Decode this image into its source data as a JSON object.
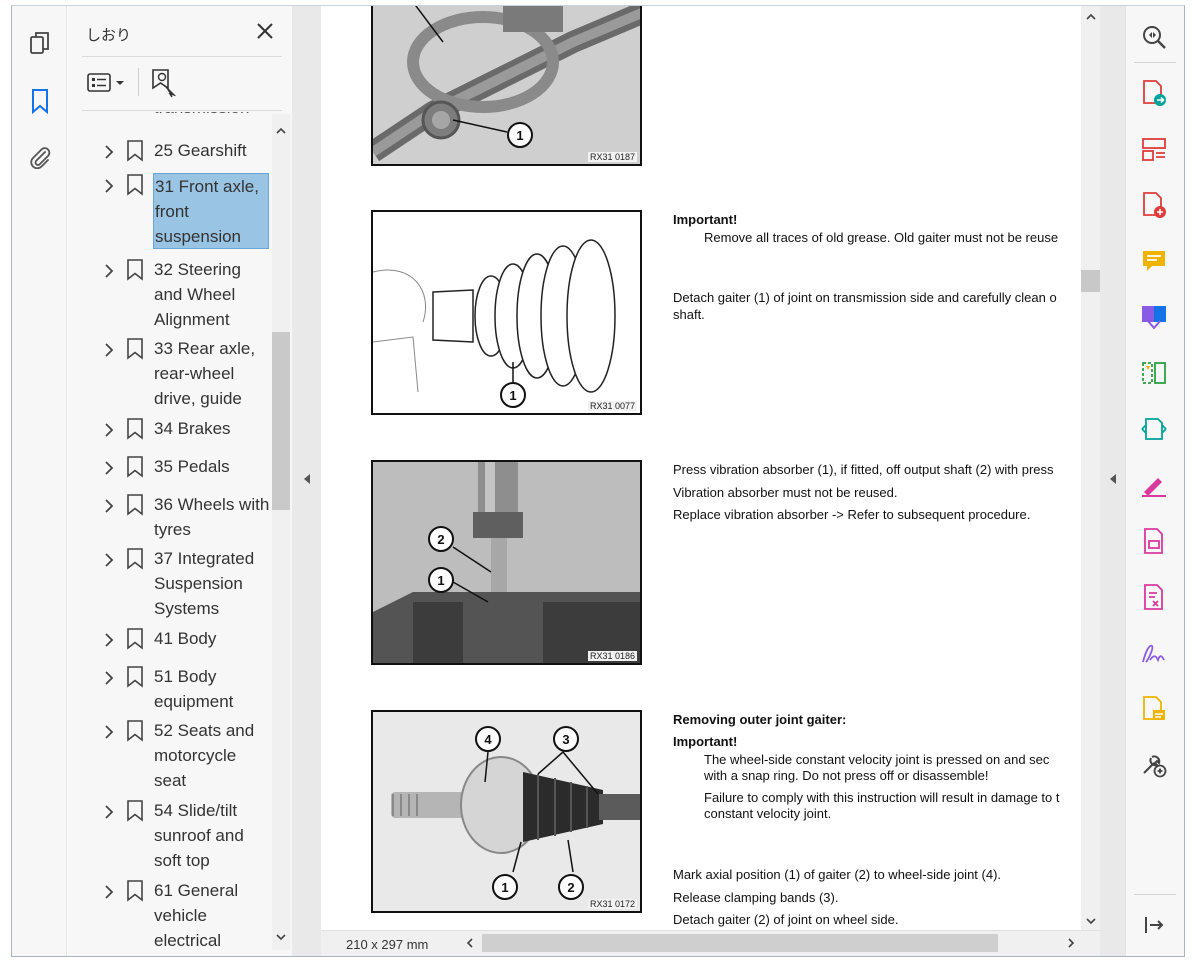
{
  "bookmarks_panel": {
    "title": "しおり",
    "partial_item": "transmission",
    "items": [
      {
        "label": "25 Gearshift",
        "selected": false
      },
      {
        "label": "31 Front axle, front suspension",
        "selected": true
      },
      {
        "label": "32 Steering and Wheel Alignment",
        "selected": false
      },
      {
        "label": "33 Rear axle, rear-wheel drive, guide",
        "selected": false
      },
      {
        "label": "34 Brakes",
        "selected": false
      },
      {
        "label": "35 Pedals",
        "selected": false
      },
      {
        "label": "36 Wheels with tyres",
        "selected": false
      },
      {
        "label": "37 Integrated Suspension Systems",
        "selected": false
      },
      {
        "label": "41 Body",
        "selected": false
      },
      {
        "label": "51 Body equipment",
        "selected": false
      },
      {
        "label": "52 Seats and motorcycle seat",
        "selected": false
      },
      {
        "label": "54 Slide/tilt sunroof and soft top",
        "selected": false
      },
      {
        "label": "61 General vehicle electrical",
        "selected": false
      }
    ]
  },
  "document": {
    "figures": [
      {
        "code": "RX31 0187",
        "callouts": [
          "1"
        ]
      },
      {
        "code": "RX31 0077",
        "callouts": [
          "1"
        ]
      },
      {
        "code": "RX31 0186",
        "callouts": [
          "2",
          "1"
        ]
      },
      {
        "code": "RX31 0172",
        "callouts": [
          "4",
          "3",
          "1",
          "2"
        ]
      }
    ],
    "text": {
      "important1": "Important!",
      "grease": "Remove all traces of old grease. Old gaiter must not be reuse",
      "detach1": "Detach gaiter (1) of joint on transmission side and carefully clean o",
      "detach1b": "shaft.",
      "press": "Press vibration absorber (1), if fitted, off output shaft (2) with press",
      "not_reused": "Vibration absorber must not be reused.",
      "replace": "Replace vibration absorber -> Refer to subsequent procedure.",
      "removing": "Removing outer joint gaiter:",
      "important2": "Important!",
      "wheelside1": "The wheel-side constant velocity joint is pressed on and sec",
      "wheelside2": "with a snap ring. Do not press off or disassemble!",
      "failure1": "Failure to comply with this instruction will result in damage to t",
      "failure2": "constant velocity joint.",
      "mark": "Mark axial position (1) of gaiter (2) to wheel-side joint (4).",
      "release": "Release clamping bands (3).",
      "detach2": "Detach gaiter (2) of joint on wheel side."
    }
  },
  "status": {
    "page_size": "210 x 297 mm"
  },
  "icons": {
    "left_rail": [
      "pages-icon",
      "bookmark-icon",
      "attachment-icon"
    ],
    "right_rail": [
      "zoom-icon",
      "export-pdf-icon",
      "organize-pages-icon",
      "create-pdf-icon",
      "comment-icon",
      "combine-files-icon",
      "compress-icon",
      "convert-icon",
      "fill-sign-icon",
      "protect-icon",
      "redact-icon",
      "signature-icon",
      "edit-pdf-icon",
      "more-tools-icon",
      "collapse-pane-icon"
    ]
  },
  "colors": {
    "selection": "#9ac4e4",
    "accent_blue": "#1473e6",
    "tool_red": "#e03c3c",
    "tool_yellow": "#f0b400",
    "tool_purple": "#8a5ce6",
    "tool_green": "#2ea043",
    "tool_teal": "#00a39b",
    "tool_pink": "#d93a9e"
  }
}
